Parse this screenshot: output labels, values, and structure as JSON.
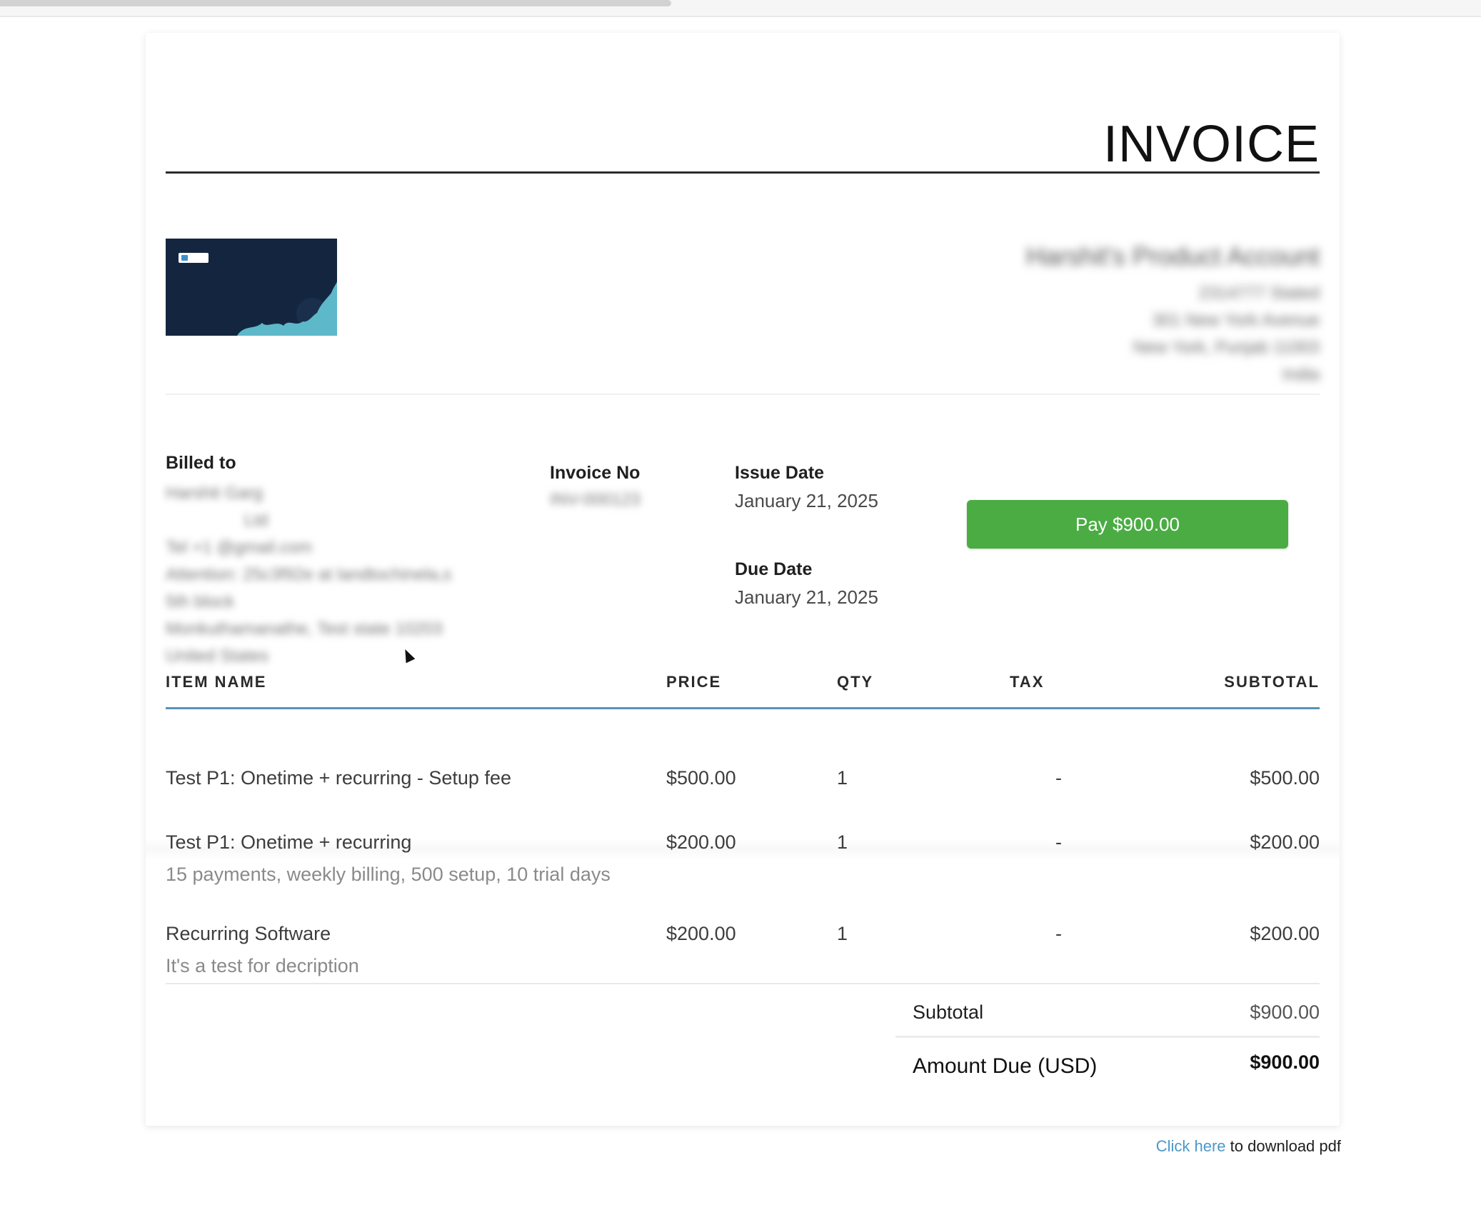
{
  "invoice": {
    "title": "INVOICE",
    "company": {
      "name": "Harshit's Product Account",
      "lines": [
        "2314777 Stated",
        "301 New York Avenue",
        "New York, Punjab 11003",
        "India"
      ]
    },
    "billed_to": {
      "label": "Billed to",
      "lines": [
        "Harshit Garg",
        "Ltd",
        "Tel +1 @gmail.com",
        "Attention: 25c3f92e at landtochinela,s",
        "5th block",
        "Monkuthamanathe, Test state 10203",
        "United States"
      ]
    },
    "invoice_no": {
      "label": "Invoice No",
      "value": "INV-000123"
    },
    "issue_date": {
      "label": "Issue Date",
      "value": "January 21, 2025"
    },
    "due_date": {
      "label": "Due Date",
      "value": "January 21, 2025"
    },
    "pay_button_label": "Pay $900.00"
  },
  "table": {
    "headers": {
      "item": "ITEM NAME",
      "price": "PRICE",
      "qty": "QTY",
      "tax": "TAX",
      "subtotal": "SUBTOTAL"
    },
    "rows": [
      {
        "name": "Test P1: Onetime + recurring - Setup fee",
        "description": "",
        "price": "$500.00",
        "qty": "1",
        "tax": "-",
        "subtotal": "$500.00"
      },
      {
        "name": "Test P1: Onetime + recurring",
        "description": "15 payments, weekly billing, 500 setup, 10 trial days",
        "price": "$200.00",
        "qty": "1",
        "tax": "-",
        "subtotal": "$200.00"
      },
      {
        "name": "Recurring Software",
        "description": "It's a test for decription",
        "price": "$200.00",
        "qty": "1",
        "tax": "-",
        "subtotal": "$200.00"
      }
    ]
  },
  "totals": {
    "subtotal_label": "Subtotal",
    "subtotal_value": "$900.00",
    "amount_due_label": "Amount Due (USD)",
    "amount_due_value": "$900.00"
  },
  "footer": {
    "link_text": "Click here",
    "suffix": " to download pdf"
  },
  "colors": {
    "pay_button": "#4aac43",
    "table_header_rule": "#5b93b6",
    "link": "#4c98c8"
  }
}
